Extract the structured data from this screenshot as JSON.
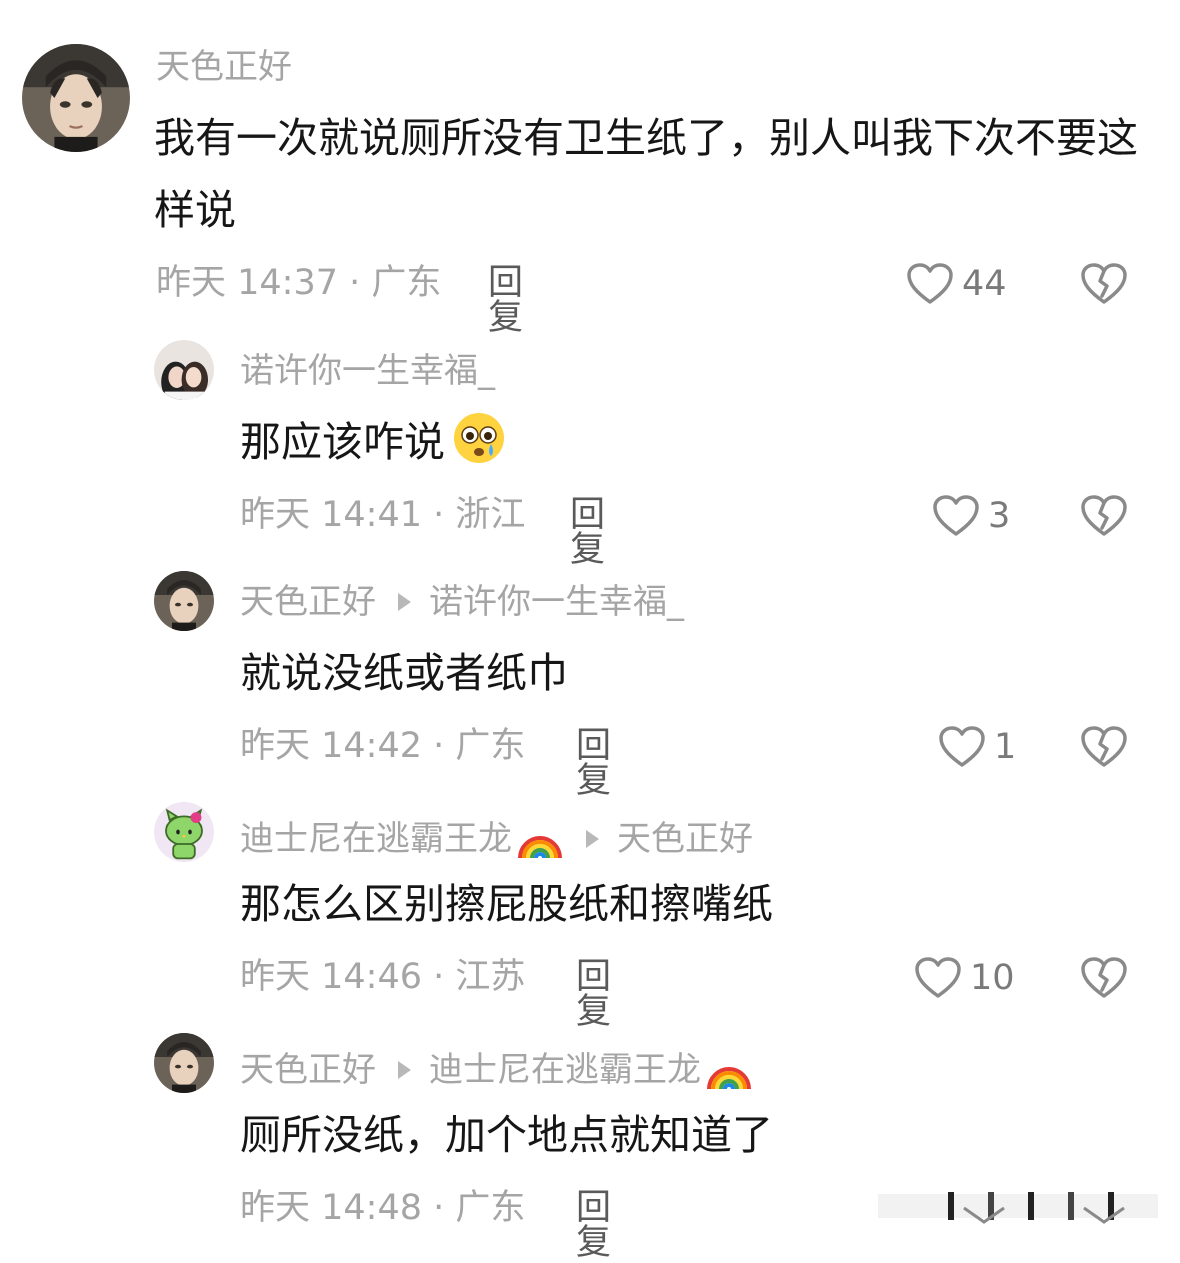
{
  "comments": [
    {
      "username": "天色正好",
      "text": "我有一次就说厕所没有卫生纸了，别人叫我下次不要这样说",
      "time_location": "昨天 14:37 · 广东",
      "reply_label": "回复",
      "likes": "44",
      "avatar_icon": "anime-man-avatar-icon"
    },
    {
      "username": "诺许你一生幸福_",
      "text": "那应该咋说",
      "emoji": "flushed-sweat-emoji",
      "time_location": "昨天 14:41 · 浙江",
      "reply_label": "回复",
      "likes": "3",
      "avatar_icon": "two-girls-photo-avatar-icon"
    },
    {
      "username": "天色正好",
      "reply_to": "诺许你一生幸福_",
      "text": "就说没纸或者纸巾",
      "time_location": "昨天 14:42 · 广东",
      "reply_label": "回复",
      "likes": "1",
      "avatar_icon": "anime-man-avatar-icon"
    },
    {
      "username": "迪士尼在逃霸王龙",
      "username_emoji": "rainbow-icon",
      "reply_to": "天色正好",
      "text": "那怎么区别擦屁股纸和擦嘴纸",
      "time_location": "昨天 14:46 · 江苏",
      "reply_label": "回复",
      "likes": "10",
      "avatar_icon": "green-hello-kitty-avatar-icon"
    },
    {
      "username": "天色正好",
      "reply_to": "迪士尼在逃霸王龙",
      "reply_to_emoji": "rainbow-icon",
      "text": "厕所没纸，加个地点就知道了",
      "time_location": "昨天 14:48 · 广东",
      "reply_label": "回复",
      "avatar_icon": "anime-man-avatar-icon"
    }
  ],
  "colors": {
    "username": "#a5a5a5",
    "text": "#161616",
    "meta": "#a5a5a5",
    "reply": "#5a5a5a",
    "icon": "#8a8a8a"
  }
}
